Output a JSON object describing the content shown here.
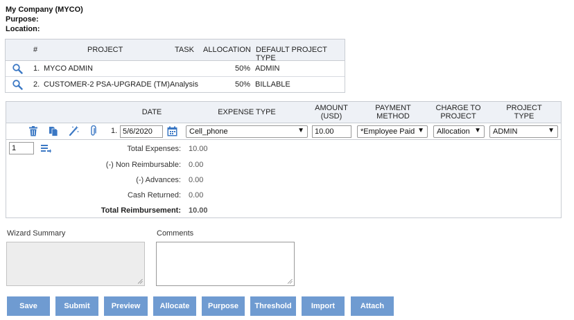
{
  "header": {
    "company": "My Company (MYCO)",
    "purpose_label": "Purpose:",
    "location_label": "Location:"
  },
  "project_table": {
    "columns": {
      "num": "#",
      "project": "PROJECT",
      "task": "TASK",
      "allocation": "ALLOCATION",
      "default_type": "DEFAULT PROJECT TYPE"
    },
    "rows": [
      {
        "num": "1.",
        "project": "MYCO ADMIN",
        "task": "",
        "allocation": "50%",
        "type": "ADMIN"
      },
      {
        "num": "2.",
        "project": "CUSTOMER-2 PSA-UPGRADE (TM)",
        "task": "Analysis",
        "allocation": "50%",
        "type": "BILLABLE"
      }
    ]
  },
  "expense_table": {
    "columns": {
      "date": "DATE",
      "expense_type": "EXPENSE TYPE",
      "amount_1": "AMOUNT",
      "amount_2": "(USD)",
      "payment_1": "PAYMENT",
      "payment_2": "METHOD",
      "charge_1": "CHARGE TO",
      "charge_2": "PROJECT",
      "ptype_1": "PROJECT",
      "ptype_2": "TYPE"
    },
    "row": {
      "num": "1.",
      "date": "5/6/2020",
      "expense_type": "Cell_phone",
      "amount": "10.00",
      "payment_method": "*Employee Paid",
      "charge_to_project": "Allocation",
      "project_type": "ADMIN"
    },
    "row_count": "1"
  },
  "totals": {
    "total_expenses_label": "Total Expenses:",
    "total_expenses": "10.00",
    "non_reimb_label": "(-) Non Reimbursable:",
    "non_reimb": "0.00",
    "advances_label": "(-) Advances:",
    "advances": "0.00",
    "cash_returned_label": "Cash Returned:",
    "cash_returned": "0.00",
    "total_reimb_label": "Total Reimbursement:",
    "total_reimb": "10.00"
  },
  "wizard_summary_label": "Wizard Summary",
  "comments_label": "Comments",
  "buttons": {
    "save": "Save",
    "submit": "Submit",
    "preview": "Preview",
    "allocate": "Allocate",
    "purpose": "Purpose",
    "threshold": "Threshold",
    "import": "Import",
    "attach": "Attach"
  },
  "colors": {
    "button": "#6f9bd1",
    "header_bg": "#eef1f6",
    "icon_blue": "#3b78c4"
  }
}
